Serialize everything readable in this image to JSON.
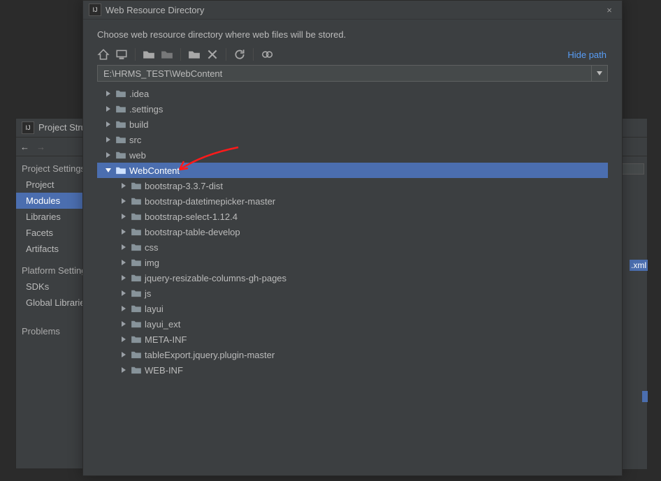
{
  "back_window": {
    "title": "Project Structure",
    "nav": {
      "left_arrow": "←",
      "right_arrow": "→"
    },
    "sidebar": {
      "section1": "Project Settings",
      "items1": [
        "Project",
        "Modules",
        "Libraries",
        "Facets",
        "Artifacts"
      ],
      "selected1": 1,
      "section2": "Platform Settings",
      "items2": [
        "SDKs",
        "Global Libraries"
      ],
      "section3": "Problems"
    },
    "tag": ".xml"
  },
  "dialog": {
    "title": "Web Resource Directory",
    "close": "×",
    "description": "Choose web resource directory where web files will be stored.",
    "hide_path": "Hide path",
    "path_value": "E:\\HRMS_TEST\\WebContent",
    "toolbar_icons": [
      "home-icon",
      "desktop-icon",
      "new-folder-icon",
      "folder-icon",
      "folder-add-icon",
      "delete-icon",
      "refresh-icon",
      "show-hidden-icon"
    ]
  },
  "tree": {
    "selected_index": 5,
    "nodes": [
      {
        "depth": 0,
        "expanded": false,
        "label": ".idea"
      },
      {
        "depth": 0,
        "expanded": false,
        "label": ".settings"
      },
      {
        "depth": 0,
        "expanded": false,
        "label": "build"
      },
      {
        "depth": 0,
        "expanded": false,
        "label": "src"
      },
      {
        "depth": 0,
        "expanded": false,
        "label": "web"
      },
      {
        "depth": 0,
        "expanded": true,
        "label": "WebContent"
      },
      {
        "depth": 1,
        "expanded": false,
        "label": "bootstrap-3.3.7-dist"
      },
      {
        "depth": 1,
        "expanded": false,
        "label": "bootstrap-datetimepicker-master"
      },
      {
        "depth": 1,
        "expanded": false,
        "label": "bootstrap-select-1.12.4"
      },
      {
        "depth": 1,
        "expanded": false,
        "label": "bootstrap-table-develop"
      },
      {
        "depth": 1,
        "expanded": false,
        "label": "css"
      },
      {
        "depth": 1,
        "expanded": false,
        "label": "img"
      },
      {
        "depth": 1,
        "expanded": false,
        "label": "jquery-resizable-columns-gh-pages"
      },
      {
        "depth": 1,
        "expanded": false,
        "label": "js"
      },
      {
        "depth": 1,
        "expanded": false,
        "label": "layui"
      },
      {
        "depth": 1,
        "expanded": false,
        "label": "layui_ext"
      },
      {
        "depth": 1,
        "expanded": false,
        "label": "META-INF"
      },
      {
        "depth": 1,
        "expanded": false,
        "label": "tableExport.jquery.plugin-master"
      },
      {
        "depth": 1,
        "expanded": false,
        "label": "WEB-INF"
      }
    ]
  }
}
